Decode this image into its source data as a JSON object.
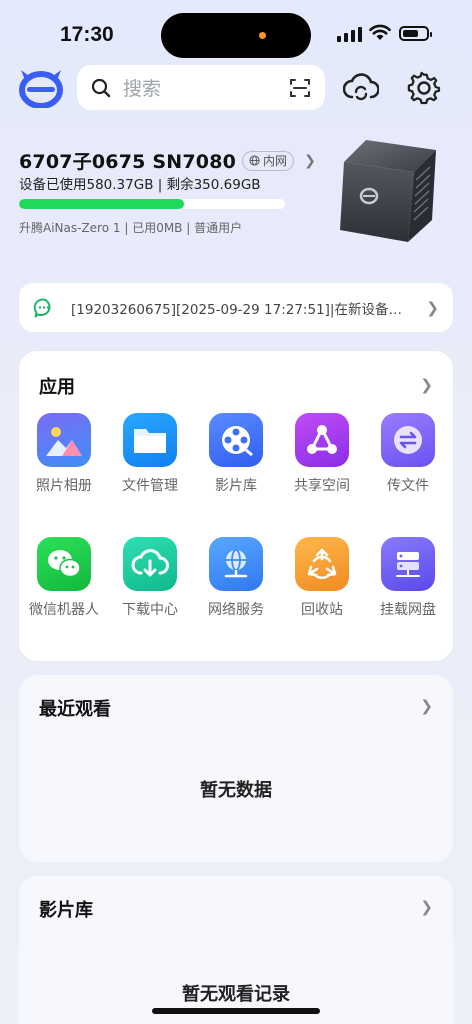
{
  "status_bar": {
    "time": "17:30"
  },
  "header": {
    "search_placeholder": "搜索"
  },
  "device": {
    "name": "6707子0675 SN7080",
    "network_badge": "内网",
    "usage": "设备已使用580.37GB | 剩余350.69GB",
    "storage_used_fraction": 0.62,
    "info": "升腾AiNas-Zero 1 | 已用0MB | 普通用户"
  },
  "notice": {
    "text": "[19203260675][2025-09-29 17:27:51]|在新设备…"
  },
  "apps": {
    "title": "应用",
    "items": [
      {
        "label": "照片相册",
        "icon": "photo-album-icon",
        "color": "#5a7cf0"
      },
      {
        "label": "文件管理",
        "icon": "folder-icon",
        "color": "#1e9bf5"
      },
      {
        "label": "影片库",
        "icon": "film-reel-icon",
        "color": "#3f6ff2"
      },
      {
        "label": "共享空间",
        "icon": "share-icon",
        "color": "#a73cf0"
      },
      {
        "label": "传文件",
        "icon": "transfer-icon",
        "color": "#7d5cf5"
      },
      {
        "label": "微信机器人",
        "icon": "wechat-icon",
        "color": "#19c64a"
      },
      {
        "label": "下载中心",
        "icon": "cloud-download-icon",
        "color": "#18c79c"
      },
      {
        "label": "网络服务",
        "icon": "globe-network-icon",
        "color": "#3f8ef5"
      },
      {
        "label": "回收站",
        "icon": "recycle-icon",
        "color": "#f5a23a"
      },
      {
        "label": "挂载网盘",
        "icon": "server-mount-icon",
        "color": "#6b5cf0"
      }
    ]
  },
  "recent": {
    "title": "最近观看",
    "empty": "暂无数据"
  },
  "library": {
    "title": "影片库",
    "empty": "暂无观看记录"
  }
}
